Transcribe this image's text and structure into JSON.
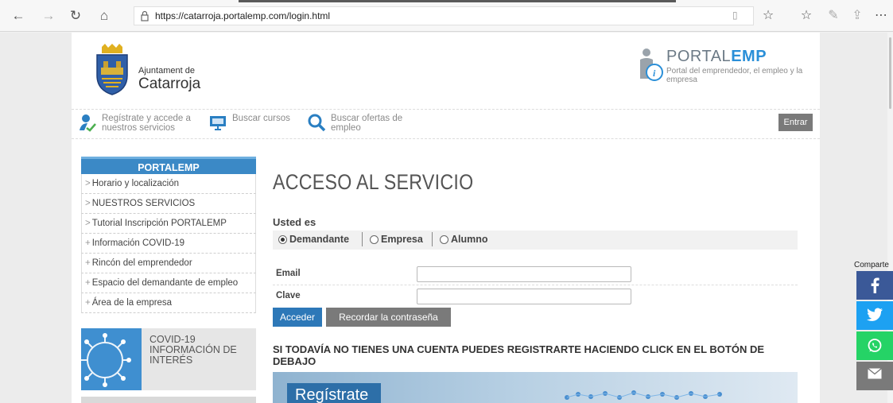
{
  "browser": {
    "url": "https://catarroja.portalemp.com/login.html",
    "icons": [
      "back-icon",
      "forward-icon",
      "refresh-icon",
      "home-icon",
      "lock-icon",
      "reading-view-icon",
      "favorite-star-icon",
      "favorites-bar-icon",
      "pen-icon",
      "share-icon",
      "more-icon"
    ]
  },
  "header": {
    "ajuntament_small": "Ajuntament de",
    "ajuntament_big": "Catarroja",
    "portal_title_a": "PORTAL",
    "portal_title_b": "EMP",
    "portal_sub": "Portal del emprendedor, el empleo y la empresa"
  },
  "toolbar": {
    "register_line1": "Regístrate y accede a",
    "register_line2": "nuestros servicios",
    "courses": "Buscar cursos",
    "jobs_line1": "Buscar ofertas de",
    "jobs_line2": "empleo",
    "enter": "Entrar"
  },
  "sidebar": {
    "heading": "PORTALEMP",
    "items": [
      {
        "prefix": ">",
        "label": "Horario y localización"
      },
      {
        "prefix": ">",
        "label": "NUESTROS SERVICIOS"
      },
      {
        "prefix": ">",
        "label": "Tutorial Inscripción PORTALEMP"
      },
      {
        "prefix": "+",
        "label": "Información COVID-19"
      },
      {
        "prefix": "+",
        "label": "Rincón del emprendedor"
      },
      {
        "prefix": "+",
        "label": "Espacio del demandante de empleo"
      },
      {
        "prefix": "+",
        "label": "Área de la empresa"
      }
    ],
    "covid_line1": "COVID-19",
    "covid_line2": "INFORMACIÓN DE",
    "covid_line3": "INTERÉS"
  },
  "main": {
    "title": "ACCESO AL SERVICIO",
    "usted_es": "Usted es",
    "roles": [
      {
        "label": "Demandante",
        "selected": true
      },
      {
        "label": "Empresa",
        "selected": false
      },
      {
        "label": "Alumno",
        "selected": false
      }
    ],
    "email_label": "Email",
    "email_value": "",
    "clave_label": "Clave",
    "clave_value": "",
    "acceder": "Acceder",
    "recordar": "Recordar la contraseña",
    "register_heading": "SI TODAVÍA NO TIENES UNA CUENTA PUEDES REGISTRARTE HACIENDO CLICK EN EL BOTÓN DE DEBAJO",
    "register_button": "Regístrate"
  },
  "share": {
    "label": "Comparte",
    "buttons": [
      {
        "name": "facebook",
        "color": "#3b5998"
      },
      {
        "name": "twitter",
        "color": "#1da1f2"
      },
      {
        "name": "whatsapp",
        "color": "#25d366"
      },
      {
        "name": "email",
        "color": "#7a7a7a"
      }
    ]
  },
  "colors": {
    "accent_blue": "#3b89c6",
    "button_gray": "#7a7a7a",
    "acceder_blue": "#2d78b8"
  }
}
